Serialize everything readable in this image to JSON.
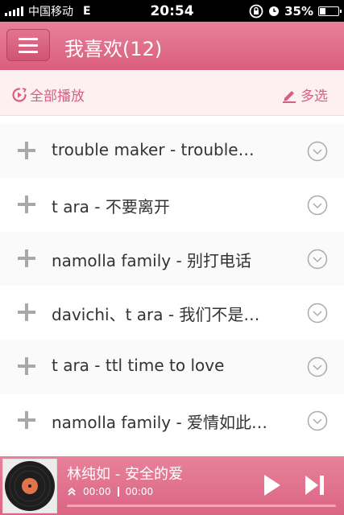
{
  "status_bar": {
    "carrier": "中国移动",
    "network": "E",
    "time": "20:54",
    "battery_percent": "35%",
    "battery_level": 0.35
  },
  "header": {
    "title": "我喜欢(12)"
  },
  "actions": {
    "play_all": "全部播放",
    "multi_select": "多选"
  },
  "songs": [
    {
      "label": "trouble maker - trouble…"
    },
    {
      "label": "t ara - 不要离开"
    },
    {
      "label": "namolla family - 别打电话"
    },
    {
      "label": "davichi、t ara - 我们不是…"
    },
    {
      "label": "t ara - ttl time to love"
    },
    {
      "label": "namolla family - 爱情如此…"
    }
  ],
  "player": {
    "now_playing": "林纯如 - 安全的爱",
    "elapsed": "00:00",
    "duration": "00:00",
    "progress": 0.0
  },
  "colors": {
    "accent": "#d95e7d",
    "header_top": "#e8819a",
    "action_bg": "#fdf0f3"
  }
}
